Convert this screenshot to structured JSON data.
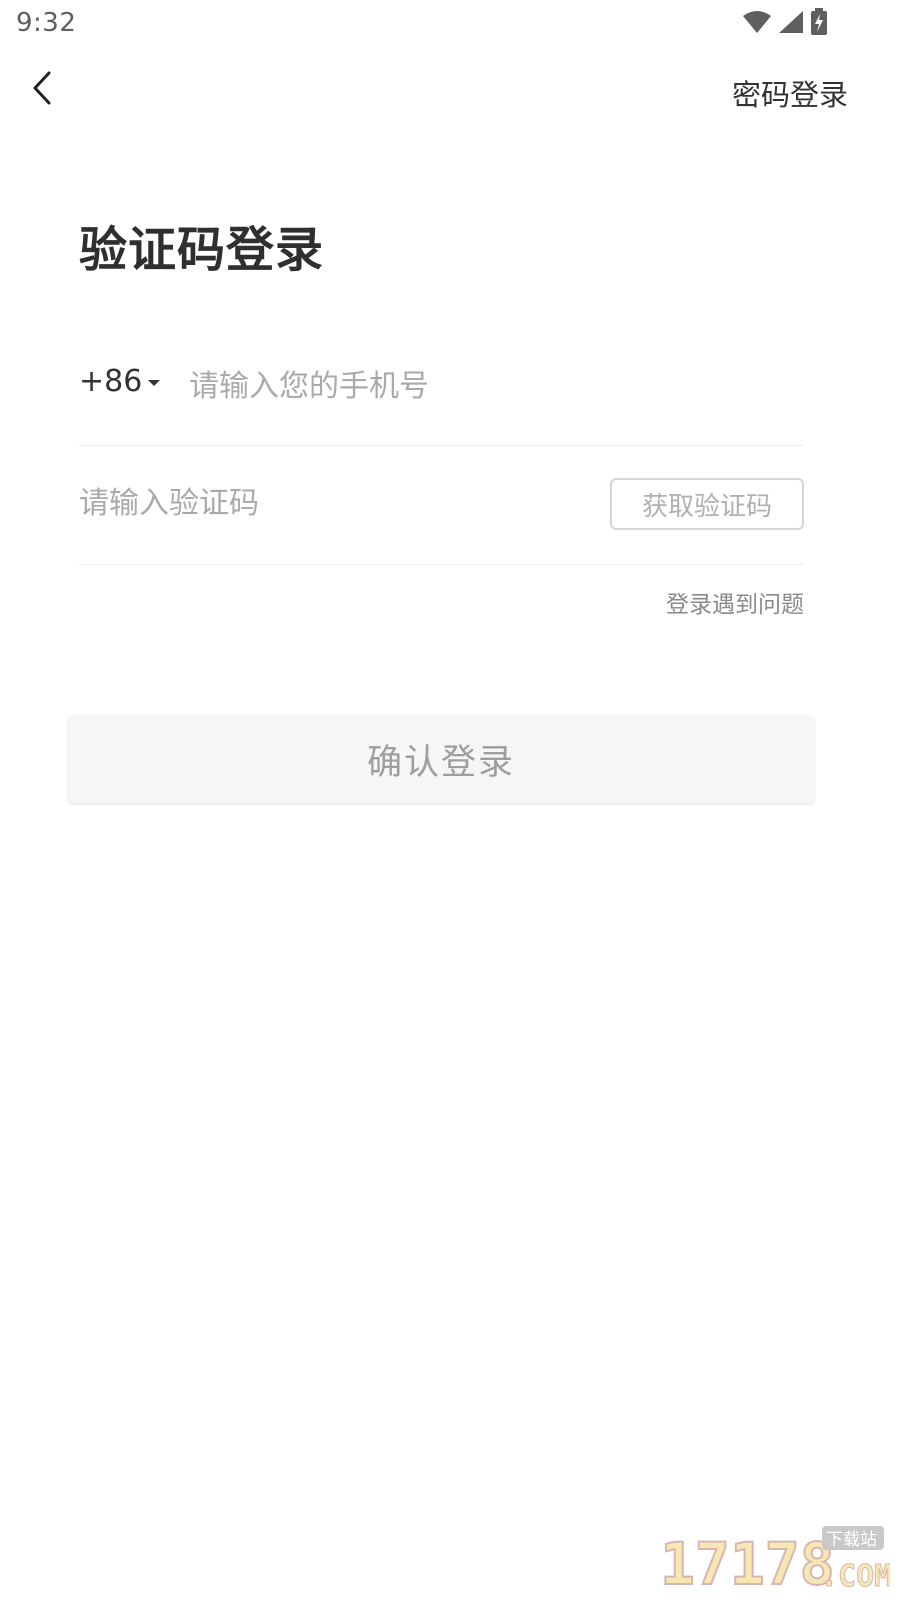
{
  "status_bar": {
    "time": "9:32",
    "icons": [
      "wifi-icon",
      "signal-icon",
      "battery-charging-icon"
    ]
  },
  "header": {
    "back_icon": "chevron-left-icon",
    "right_link": "密码登录"
  },
  "main": {
    "title": "验证码登录",
    "phone": {
      "country_code": "+86",
      "placeholder": "请输入您的手机号",
      "value": ""
    },
    "code": {
      "placeholder": "请输入验证码",
      "value": "",
      "get_code_label": "获取验证码"
    },
    "help_link": "登录遇到问题",
    "confirm_label": "确认登录"
  },
  "watermark": {
    "text": "17178",
    "suffix": ".COM",
    "tag": "下载站"
  },
  "colors": {
    "title": "#2f2f2f",
    "placeholder": "#aaaaaa",
    "divider": "#eeeeee",
    "button_bg": "#f6f6f6",
    "button_text": "#9e9e9e"
  }
}
